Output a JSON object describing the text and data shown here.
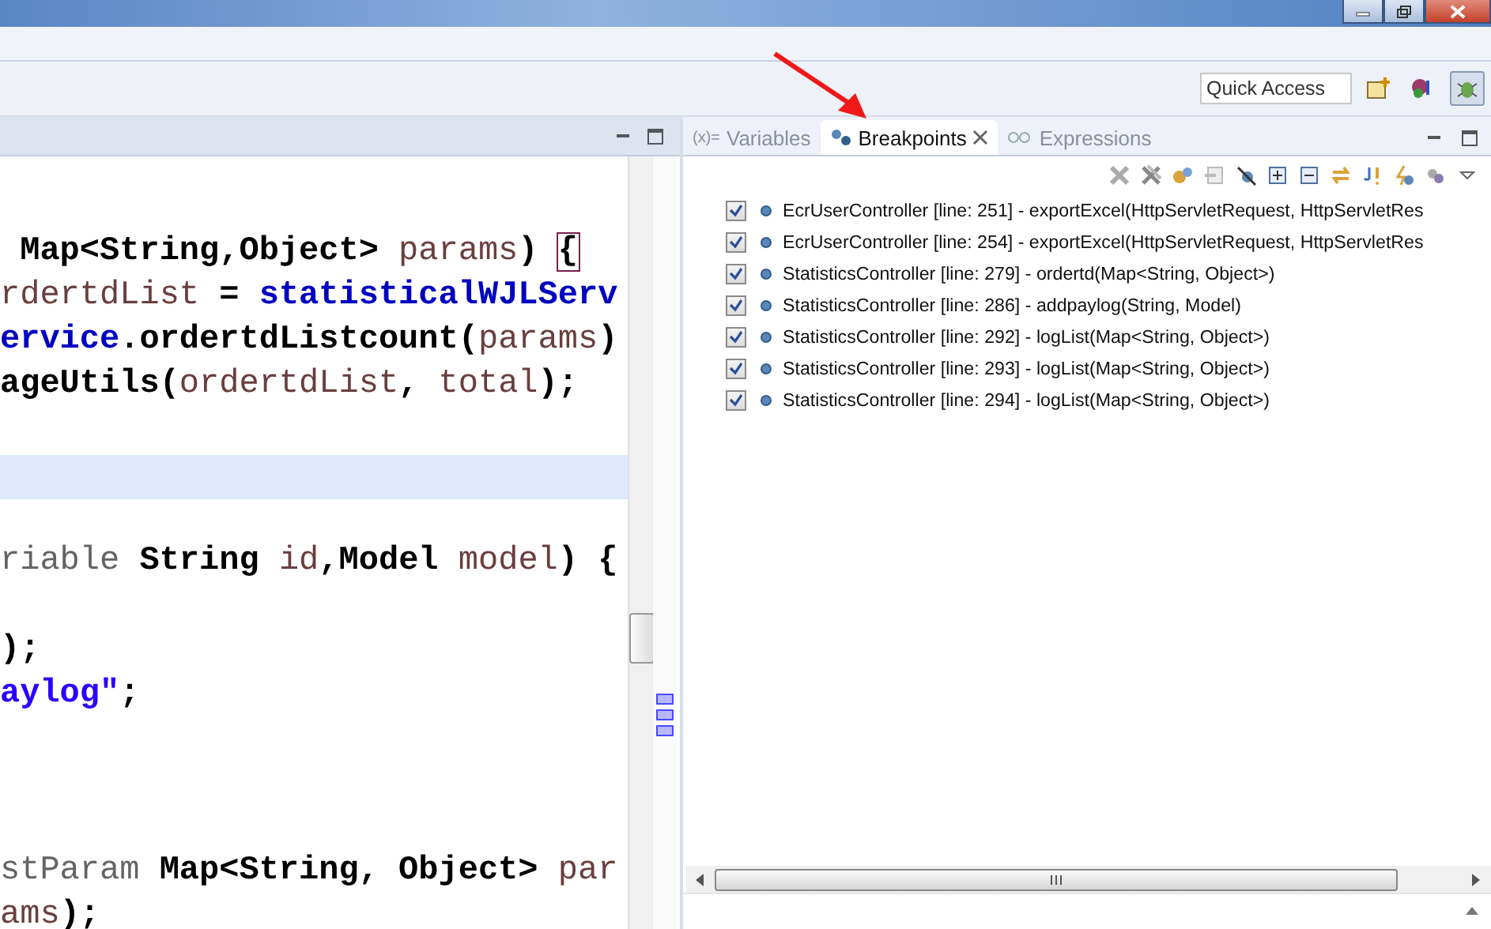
{
  "toolbar": {
    "quick_access": {
      "placeholder": "Quick Access"
    },
    "perspectives": [
      {
        "kind": "open",
        "selected": false
      },
      {
        "kind": "java",
        "selected": false
      },
      {
        "kind": "debug",
        "selected": true
      }
    ]
  },
  "editor": {
    "lines": [
      {
        "highlighted": false,
        "tokens": [
          {
            "kind": "plain",
            "text": " Map<String,Object> "
          },
          {
            "kind": "local",
            "text": "params"
          },
          {
            "kind": "plain",
            "text": ") "
          },
          {
            "kind": "bracket",
            "text": "{"
          }
        ]
      },
      {
        "highlighted": false,
        "tokens": [
          {
            "kind": "local",
            "text": "rdertdList"
          },
          {
            "kind": "plain",
            "text": " = "
          },
          {
            "kind": "field",
            "text": "statisticalWJLServ"
          }
        ]
      },
      {
        "highlighted": false,
        "tokens": [
          {
            "kind": "field",
            "text": "ervice"
          },
          {
            "kind": "plain",
            "text": ".ordertdListcount("
          },
          {
            "kind": "local",
            "text": "params"
          },
          {
            "kind": "plain",
            "text": ")"
          }
        ]
      },
      {
        "highlighted": false,
        "tokens": [
          {
            "kind": "plain",
            "text": "ageUtils("
          },
          {
            "kind": "local",
            "text": "ordertdList"
          },
          {
            "kind": "plain",
            "text": ", "
          },
          {
            "kind": "local",
            "text": "total"
          },
          {
            "kind": "plain",
            "text": ");"
          }
        ]
      },
      {
        "highlighted": false
      },
      {
        "highlighted": true
      },
      {
        "highlighted": false
      },
      {
        "highlighted": false,
        "tokens": [
          {
            "kind": "annotation",
            "text": "riable"
          },
          {
            "kind": "plain",
            "text": " String "
          },
          {
            "kind": "local",
            "text": "id"
          },
          {
            "kind": "plain",
            "text": ",Model "
          },
          {
            "kind": "local",
            "text": "model"
          },
          {
            "kind": "plain",
            "text": ") {"
          }
        ]
      },
      {
        "highlighted": false
      },
      {
        "highlighted": false,
        "tokens": [
          {
            "kind": "plain",
            "text": ");"
          }
        ]
      },
      {
        "highlighted": false,
        "tokens": [
          {
            "kind": "string",
            "text": "aylog\""
          },
          {
            "kind": "plain",
            "text": ";"
          }
        ]
      },
      {
        "highlighted": false
      },
      {
        "highlighted": false
      },
      {
        "highlighted": false
      },
      {
        "highlighted": false,
        "tokens": [
          {
            "kind": "annotation",
            "text": "stParam"
          },
          {
            "kind": "plain",
            "text": " Map<String, Object> "
          },
          {
            "kind": "local",
            "text": "par"
          }
        ]
      },
      {
        "highlighted": false,
        "tokens": [
          {
            "kind": "local",
            "text": "ams"
          },
          {
            "kind": "plain",
            "text": ");"
          }
        ]
      }
    ]
  },
  "debug_view": {
    "tabs": [
      {
        "label": "Variables",
        "icon_text": "(x)=",
        "selected": false
      },
      {
        "label": "Breakpoints",
        "selected": true
      },
      {
        "label": "Expressions",
        "selected": false
      }
    ],
    "breakpoints": [
      {
        "checked": true,
        "text": "EcrUserController [line: 251] - exportExcel(HttpServletRequest, HttpServletRes"
      },
      {
        "checked": true,
        "text": "EcrUserController [line: 254] - exportExcel(HttpServletRequest, HttpServletRes"
      },
      {
        "checked": true,
        "text": "StatisticsController [line: 279] - ordertd(Map<String, Object>)"
      },
      {
        "checked": true,
        "text": "StatisticsController [line: 286] - addpaylog(String, Model)"
      },
      {
        "checked": true,
        "text": "StatisticsController [line: 292] - logList(Map<String, Object>)"
      },
      {
        "checked": true,
        "text": "StatisticsController [line: 293] - logList(Map<String, Object>)"
      },
      {
        "checked": true,
        "text": "StatisticsController [line: 294] - logList(Map<String, Object>)"
      }
    ]
  }
}
